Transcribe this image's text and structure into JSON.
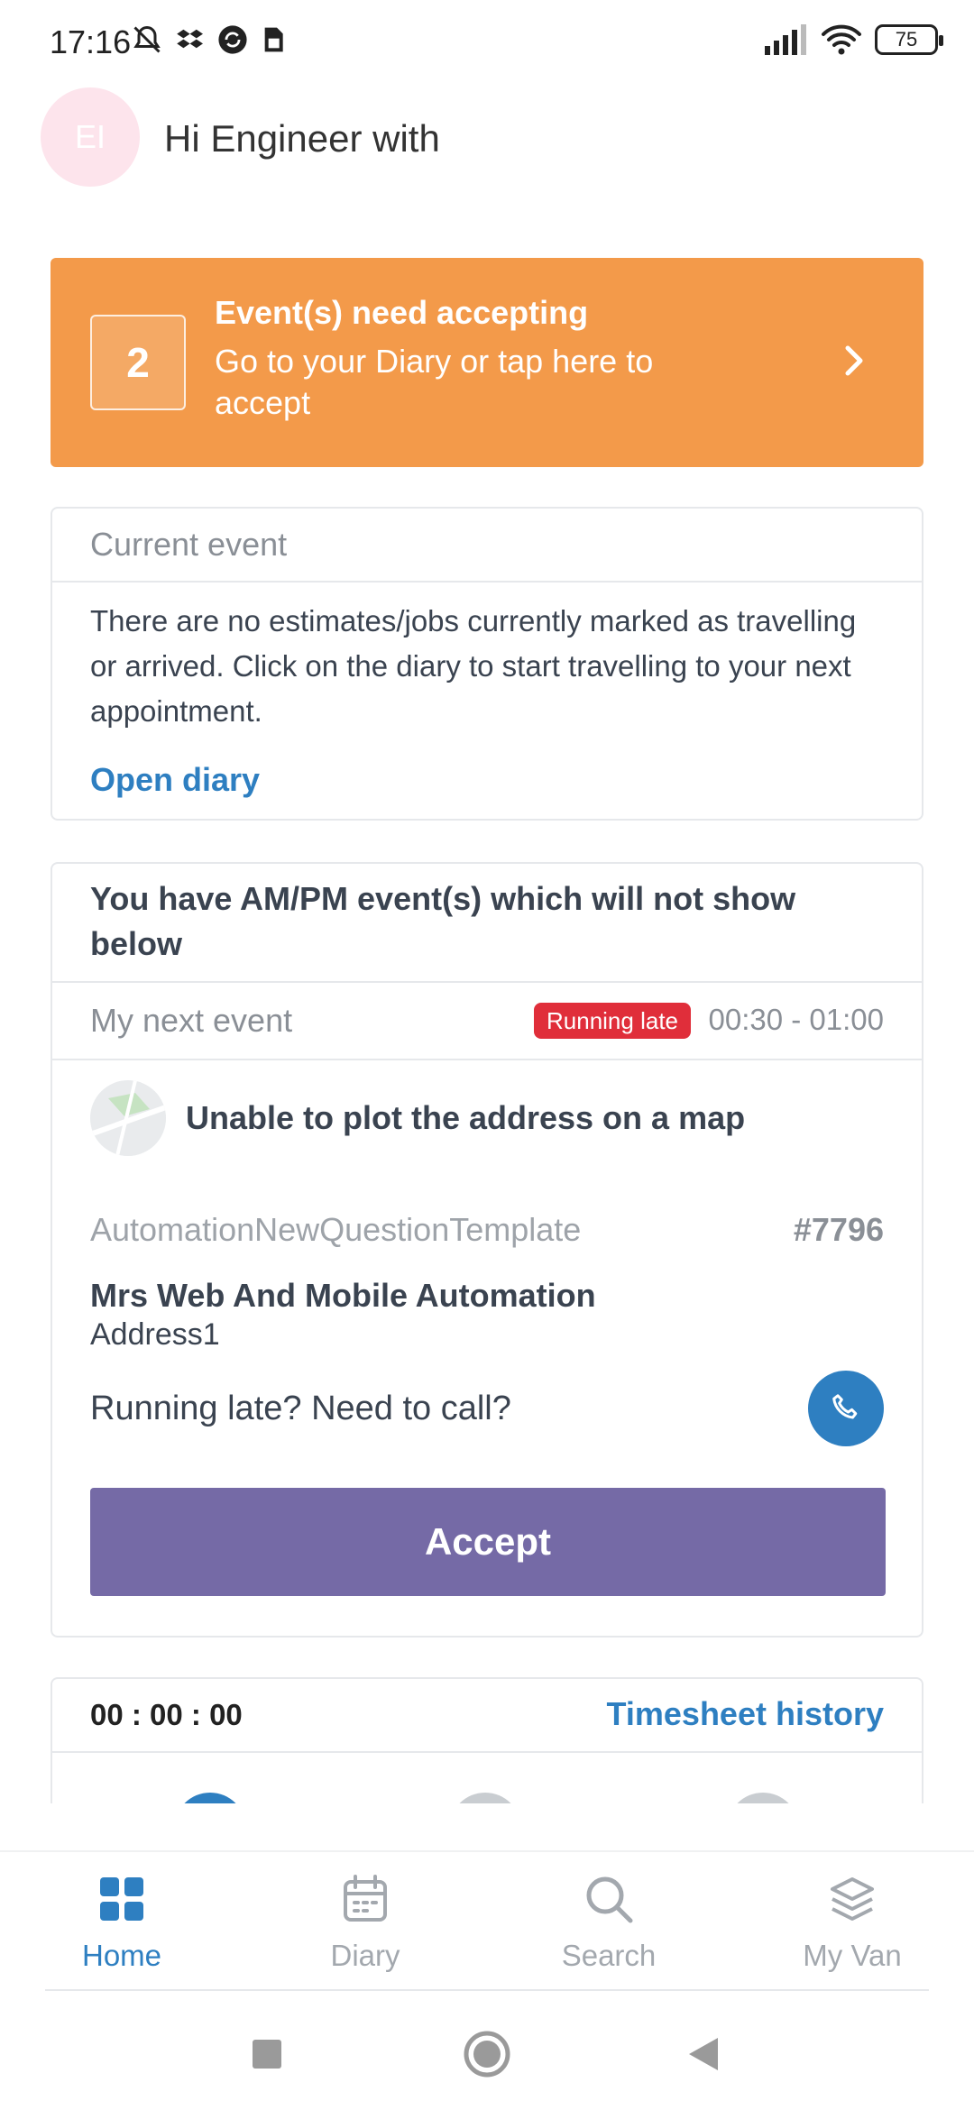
{
  "status_bar": {
    "time": "17:16",
    "battery": "75"
  },
  "greeting": {
    "avatar_initials": "EI",
    "text": "Hi Engineer with"
  },
  "banner": {
    "count": "2",
    "title": "Event(s) need accepting",
    "subtitle": "Go to your Diary or tap here to accept"
  },
  "current_event": {
    "header": "Current event",
    "body": "There are no estimates/jobs currently marked as travelling or arrived. Click on the diary to start travelling to your next appointment.",
    "link": "Open diary"
  },
  "next_event": {
    "ampm_notice": "You have AM/PM event(s) which will not show below",
    "header": "My next event",
    "status_badge": "Running late",
    "time_range": "00:30 - 01:00",
    "map_message": "Unable to plot the address on a map",
    "template": "AutomationNewQuestionTemplate",
    "job_number": "#7796",
    "customer": "Mrs Web And Mobile Automation",
    "address": "Address1",
    "call_prompt": "Running late? Need to call?",
    "accept_label": "Accept"
  },
  "timesheet": {
    "timer": "00 : 00 : 00",
    "history_link": "Timesheet history"
  },
  "bottom_nav": {
    "items": [
      {
        "label": "Home",
        "icon": "home-grid-icon",
        "active": true
      },
      {
        "label": "Diary",
        "icon": "calendar-icon",
        "active": false
      },
      {
        "label": "Search",
        "icon": "search-icon",
        "active": false
      },
      {
        "label": "My Van",
        "icon": "layers-icon",
        "active": false
      }
    ]
  },
  "colors": {
    "accent": "#2e7fc1",
    "banner": "#f39a4a",
    "accept": "#756aa6",
    "late": "#e02e3a"
  }
}
